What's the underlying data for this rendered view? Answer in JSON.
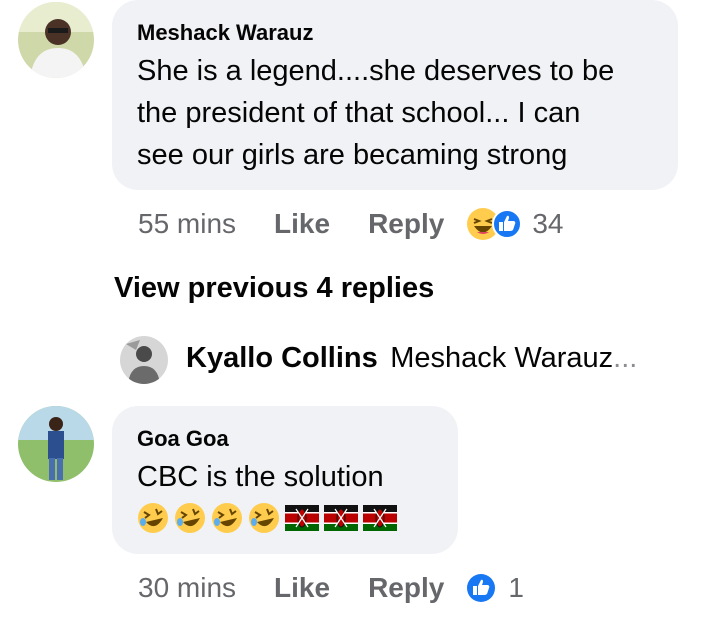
{
  "comments": [
    {
      "author": "Meshack Warauz",
      "text_lines": [
        "She is a legend....she deserves to be",
        "the president of that school... I can",
        "see our girls are becaming strong"
      ],
      "time": "55 mins",
      "like_label": "Like",
      "reply_label": "Reply",
      "reactions": [
        "laughing-emoji",
        "like-icon"
      ],
      "reaction_count": "34"
    },
    {
      "author": "Goa Goa",
      "text": "CBC is the solution",
      "emojis": [
        "rofl-emoji",
        "rofl-emoji",
        "rofl-emoji",
        "rofl-emoji",
        "kenya-flag",
        "kenya-flag",
        "kenya-flag"
      ],
      "time": "30 mins",
      "like_label": "Like",
      "reply_label": "Reply",
      "reactions": [
        "like-icon"
      ],
      "reaction_count": "1"
    }
  ],
  "view_previous": "View previous 4 replies",
  "reply_preview": {
    "author": "Kyallo Collins",
    "snippet": "Meshack Warauz",
    "ellipsis": "..."
  },
  "colors": {
    "bubble": "#f0f2f5",
    "meta_text": "#65676b",
    "like_blue": "#1877f2",
    "emoji_yellow": "#ffcc4d"
  }
}
